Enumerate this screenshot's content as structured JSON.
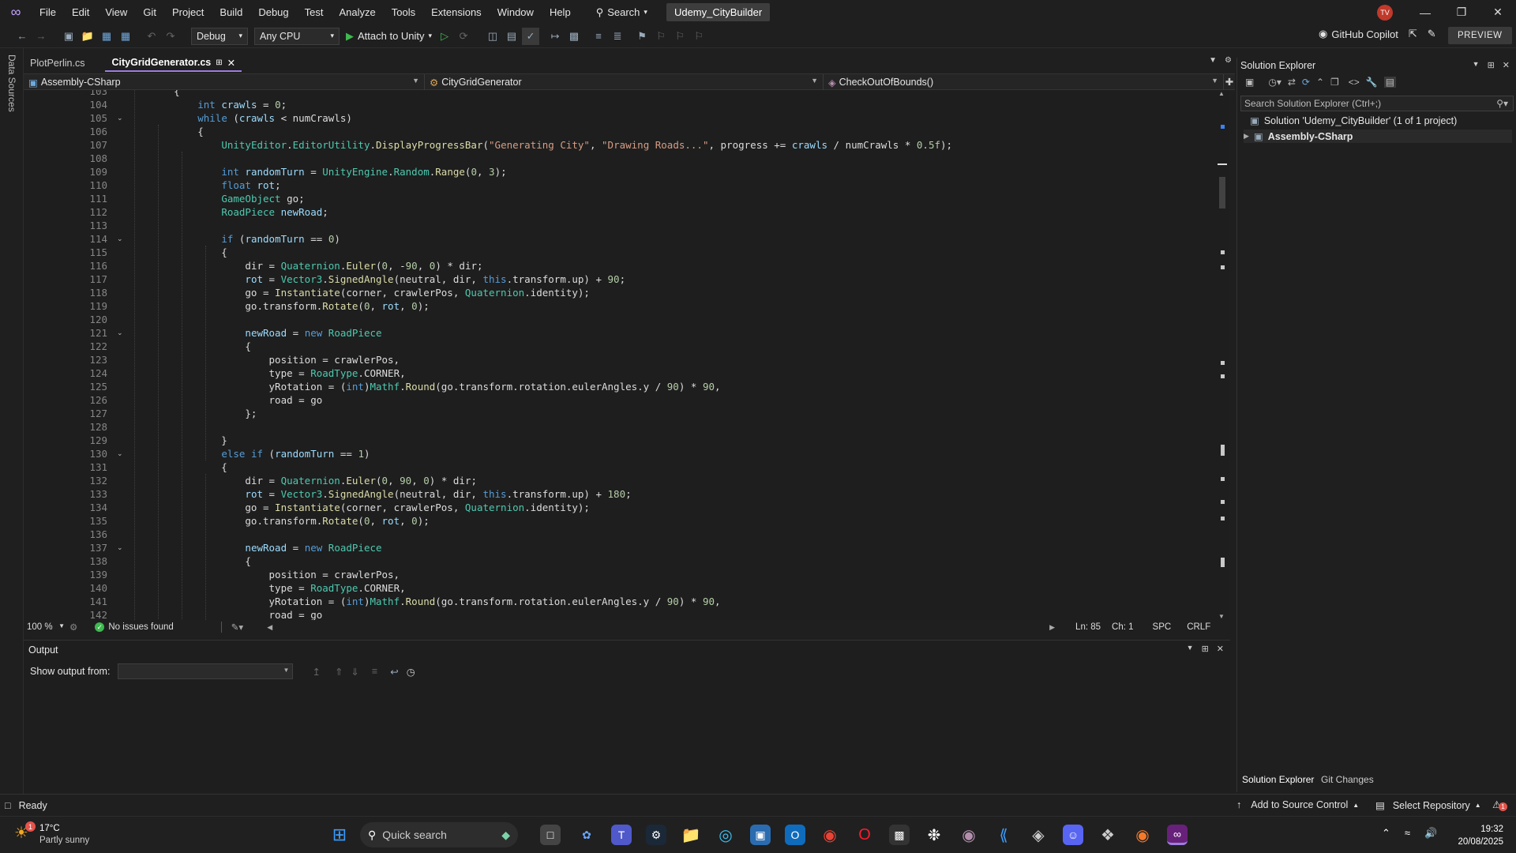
{
  "menubar": {
    "items": [
      "File",
      "Edit",
      "View",
      "Git",
      "Project",
      "Build",
      "Debug",
      "Test",
      "Analyze",
      "Tools",
      "Extensions",
      "Window",
      "Help"
    ],
    "search_label": "Search",
    "solution_name": "Udemy_CityBuilder",
    "avatar_initials": "TV"
  },
  "toolbar": {
    "config": "Debug",
    "platform": "Any CPU",
    "attach_label": "Attach to Unity",
    "copilot_label": "GitHub Copilot",
    "preview_label": "PREVIEW"
  },
  "leftrail": {
    "label": "Data Sources"
  },
  "tabs": [
    {
      "label": "PlotPerlin.cs",
      "active": false
    },
    {
      "label": "CityGridGenerator.cs",
      "active": true
    }
  ],
  "navbar": {
    "project": "Assembly-CSharp",
    "type": "CityGridGenerator",
    "member": "CheckOutOfBounds()"
  },
  "editor": {
    "line_numbers": [
      "103",
      "104",
      "105",
      "106",
      "107",
      "108",
      "109",
      "110",
      "111",
      "112",
      "113",
      "114",
      "115",
      "116",
      "117",
      "118",
      "119",
      "120",
      "121",
      "122",
      "123",
      "124",
      "125",
      "126",
      "127",
      "128",
      "129",
      "130",
      "131",
      "132",
      "133",
      "134",
      "135",
      "136",
      "137",
      "138",
      "139",
      "140",
      "141",
      "142"
    ],
    "fold_lines": [
      "105",
      "114",
      "121",
      "130",
      "137"
    ],
    "code_lines": [
      "    {",
      "        int crawls = 0;",
      "        while (crawls < numCrawls)",
      "        {",
      "            UnityEditor.EditorUtility.DisplayProgressBar(\"Generating City\", \"Drawing Roads...\", progress += crawls / numCrawls * 0.5f);",
      "",
      "            int randomTurn = UnityEngine.Random.Range(0, 3);",
      "            float rot;",
      "            GameObject go;",
      "            RoadPiece newRoad;",
      "",
      "            if (randomTurn == 0)",
      "            {",
      "                dir = Quaternion.Euler(0, -90, 0) * dir;",
      "                rot = Vector3.SignedAngle(neutral, dir, this.transform.up) + 90;",
      "                go = Instantiate(corner, crawlerPos, Quaternion.identity);",
      "                go.transform.Rotate(0, rot, 0);",
      "",
      "                newRoad = new RoadPiece",
      "                {",
      "                    position = crawlerPos,",
      "                    type = RoadType.CORNER,",
      "                    yRotation = (int)Mathf.Round(go.transform.rotation.eulerAngles.y / 90) * 90,",
      "                    road = go",
      "                };",
      "",
      "            }",
      "            else if (randomTurn == 1)",
      "            {",
      "                dir = Quaternion.Euler(0, 90, 0) * dir;",
      "                rot = Vector3.SignedAngle(neutral, dir, this.transform.up) + 180;",
      "                go = Instantiate(corner, crawlerPos, Quaternion.identity);",
      "                go.transform.Rotate(0, rot, 0);",
      "",
      "                newRoad = new RoadPiece",
      "                {",
      "                    position = crawlerPos,",
      "                    type = RoadType.CORNER,",
      "                    yRotation = (int)Mathf.Round(go.transform.rotation.eulerAngles.y / 90) * 90,",
      "                    road = go"
    ]
  },
  "editor_status": {
    "zoom": "100 %",
    "issues": "No issues found",
    "line": "Ln: 85",
    "col": "Ch: 1",
    "spacing": "SPC",
    "eol": "CRLF"
  },
  "output": {
    "title": "Output",
    "show_from_label": "Show output from:"
  },
  "solution_explorer": {
    "title": "Solution Explorer",
    "search_placeholder": "Search Solution Explorer (Ctrl+;)",
    "solution_label": "Solution 'Udemy_CityBuilder' (1 of 1 project)",
    "project_label": "Assembly-CSharp",
    "bottom_tabs": [
      "Solution Explorer",
      "Git Changes"
    ]
  },
  "statusbar": {
    "ready": "Ready",
    "source_control": "Add to Source Control",
    "repository": "Select Repository",
    "notification_count": "1"
  },
  "taskbar": {
    "temperature": "17°C",
    "weather": "Partly sunny",
    "weather_badge": "1",
    "search_label": "Quick search",
    "time": "19:32",
    "date": "20/08/2025"
  }
}
